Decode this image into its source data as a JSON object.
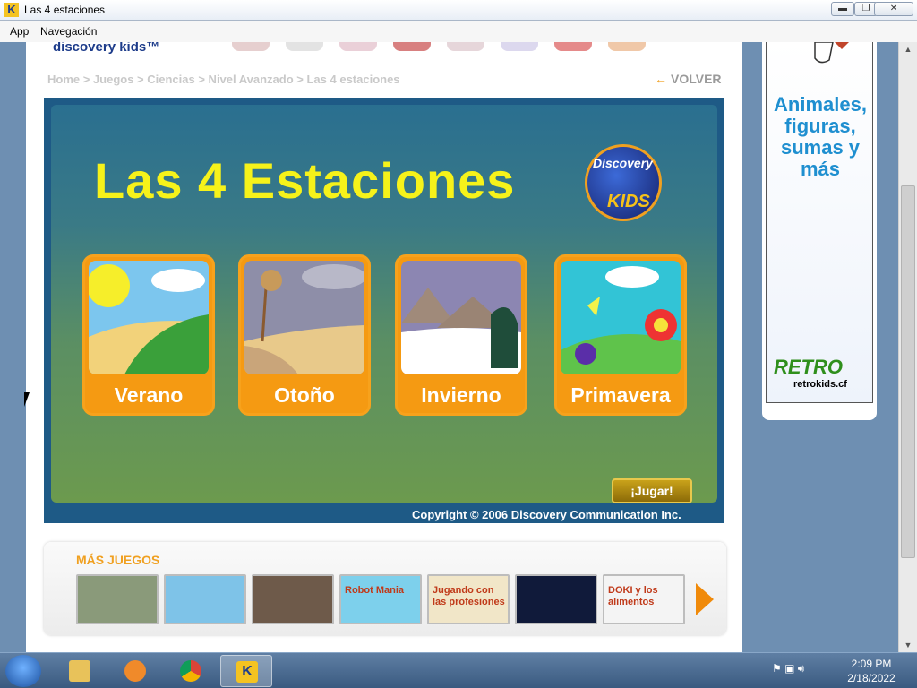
{
  "window": {
    "title": "Las 4 estaciones",
    "app_icon": "K",
    "minimize": "▬",
    "maximize": "❐",
    "close": "✕"
  },
  "menu": {
    "items": [
      "App",
      "Navegación"
    ]
  },
  "site": {
    "logo": "discovery kids™",
    "breadcrumb": "Home > Juegos > Ciencias > Nivel Avanzado > Las 4 estaciones",
    "volver": "VOLVER"
  },
  "game": {
    "title": "Las 4 Estaciones",
    "logo_top": "Discovery",
    "logo_bottom": "KIDS",
    "seasons": [
      {
        "label": "Verano",
        "sky": "#7cc6ee",
        "ground": "#f2d27a",
        "hill": "#3aa03a"
      },
      {
        "label": "Otoño",
        "sky": "#8e8ea8",
        "ground": "#e8c98a",
        "hill": "#b08a64"
      },
      {
        "label": "Invierno",
        "sky": "#8c86b2",
        "ground": "#ffffff",
        "hill": "#a08a7a"
      },
      {
        "label": "Primavera",
        "sky": "#32c4d6",
        "ground": "#5fc34b",
        "hill": "#2d9a3a"
      }
    ],
    "play_button": "¡Jugar!",
    "copyright": "Copyright © 2006 Discovery Communication Inc."
  },
  "more_games": {
    "title": "MÁS JUEGOS",
    "thumbs": [
      {
        "name": "game-thumb-castle",
        "color": "#8a9a7a",
        "text": ""
      },
      {
        "name": "game-thumb-kids",
        "color": "#7ec3e8",
        "text": ""
      },
      {
        "name": "game-thumb-doki-room",
        "color": "#6e5a4a",
        "text": ""
      },
      {
        "name": "game-thumb-robot-mania",
        "color": "#7dd0ec",
        "text": "Robot Mania"
      },
      {
        "name": "game-thumb-profesiones",
        "color": "#f1e6c8",
        "text": "Jugando con las profesiones"
      },
      {
        "name": "game-thumb-space",
        "color": "#101a3a",
        "text": ""
      },
      {
        "name": "game-thumb-doki-alimentos",
        "color": "#f4f4f4",
        "text": "DOKI y los alimentos"
      }
    ]
  },
  "ad": {
    "text": "Animales, figuras, sumas y más",
    "brand": "RETRO",
    "url": "retrokids.cf"
  },
  "taskbar": {
    "time": "2:09 PM",
    "date": "2/18/2022"
  }
}
